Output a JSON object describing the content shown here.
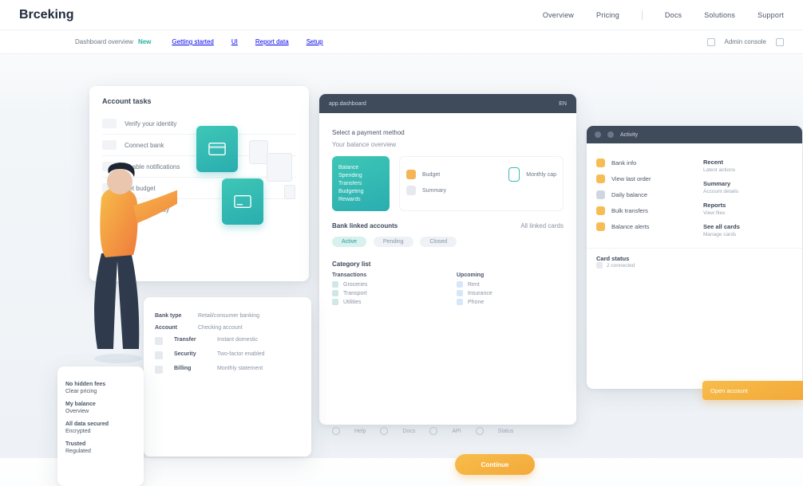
{
  "brand": "Brceking",
  "topnav": [
    "Overview",
    "Pricing",
    "Docs",
    "Solutions",
    "Support"
  ],
  "subbar": {
    "crumb_a": "Dashboard overview",
    "crumb_tag": "New",
    "links": [
      "Getting started",
      "UI",
      "Report data",
      "Setup"
    ],
    "right_label": "Admin console",
    "right_icon": "settings-icon"
  },
  "cardA": {
    "title": "Account tasks",
    "rows": [
      "Verify your identity",
      "Connect bank",
      "Enable notifications",
      "Set budget",
      "Review security"
    ]
  },
  "cardB": {
    "hdr_left": "app.dashboard",
    "hdr_right": "EN",
    "line1": "Select a payment method",
    "line2": "Your balance overview",
    "tealbox": [
      "Balance",
      "Spending",
      "Transfers",
      "Budgeting",
      "Rewards"
    ],
    "pale_a": {
      "label": "Budget",
      "sub": "Monthly cap"
    },
    "pale_b": {
      "label": "Summary"
    },
    "sec1_title": "Bank linked accounts",
    "sec1_right": "All linked cards",
    "pillbtns": [
      "Active",
      "Pending",
      "Closed"
    ],
    "sec2_title": "Category list",
    "cols": [
      {
        "label": "Transactions",
        "items": [
          "Groceries",
          "Transport",
          "Utilities"
        ]
      },
      {
        "label": "Upcoming",
        "items": [
          "Rent",
          "Insurance",
          "Phone"
        ]
      }
    ],
    "cta": "Continue"
  },
  "cardC": {
    "hdr": "Activity",
    "left": [
      {
        "t": "Bank info",
        "c": "y"
      },
      {
        "t": "View last order",
        "c": "y"
      },
      {
        "t": "Daily balance",
        "c": "g"
      },
      {
        "t": "Bulk transfers",
        "c": "y"
      },
      {
        "t": "Balance alerts",
        "c": "y"
      }
    ],
    "right": [
      {
        "h": "Recent",
        "s": "Latest actions"
      },
      {
        "h": "Summary",
        "s": "Account details"
      },
      {
        "h": "Reports",
        "s": "View files"
      },
      {
        "h": "See all cards",
        "s": "Manage cards"
      }
    ],
    "foot_h": "Card status",
    "foot_s": "2 connected",
    "cta": "Open account"
  },
  "cardD": {
    "rows": [
      {
        "k": "Bank type",
        "v": "Retail/consumer banking"
      },
      {
        "k": "Account",
        "v": "Checking account"
      },
      {
        "k": "Transfer",
        "v": "Instant domestic"
      },
      {
        "k": "Security",
        "v": "Two-factor enabled"
      },
      {
        "k": "Billing",
        "v": "Monthly statement"
      }
    ]
  },
  "cardE": {
    "rows": [
      {
        "h": "No hidden fees",
        "s": "Clear pricing"
      },
      {
        "h": "My balance",
        "s": "Overview"
      },
      {
        "h": "All data secured",
        "s": "Encrypted"
      },
      {
        "h": "Trusted",
        "s": "Regulated"
      }
    ]
  },
  "btm": [
    "Help",
    "Docs",
    "API",
    "Status"
  ],
  "colors": {
    "teal": "#2aadb0",
    "orange": "#f3a93a"
  }
}
